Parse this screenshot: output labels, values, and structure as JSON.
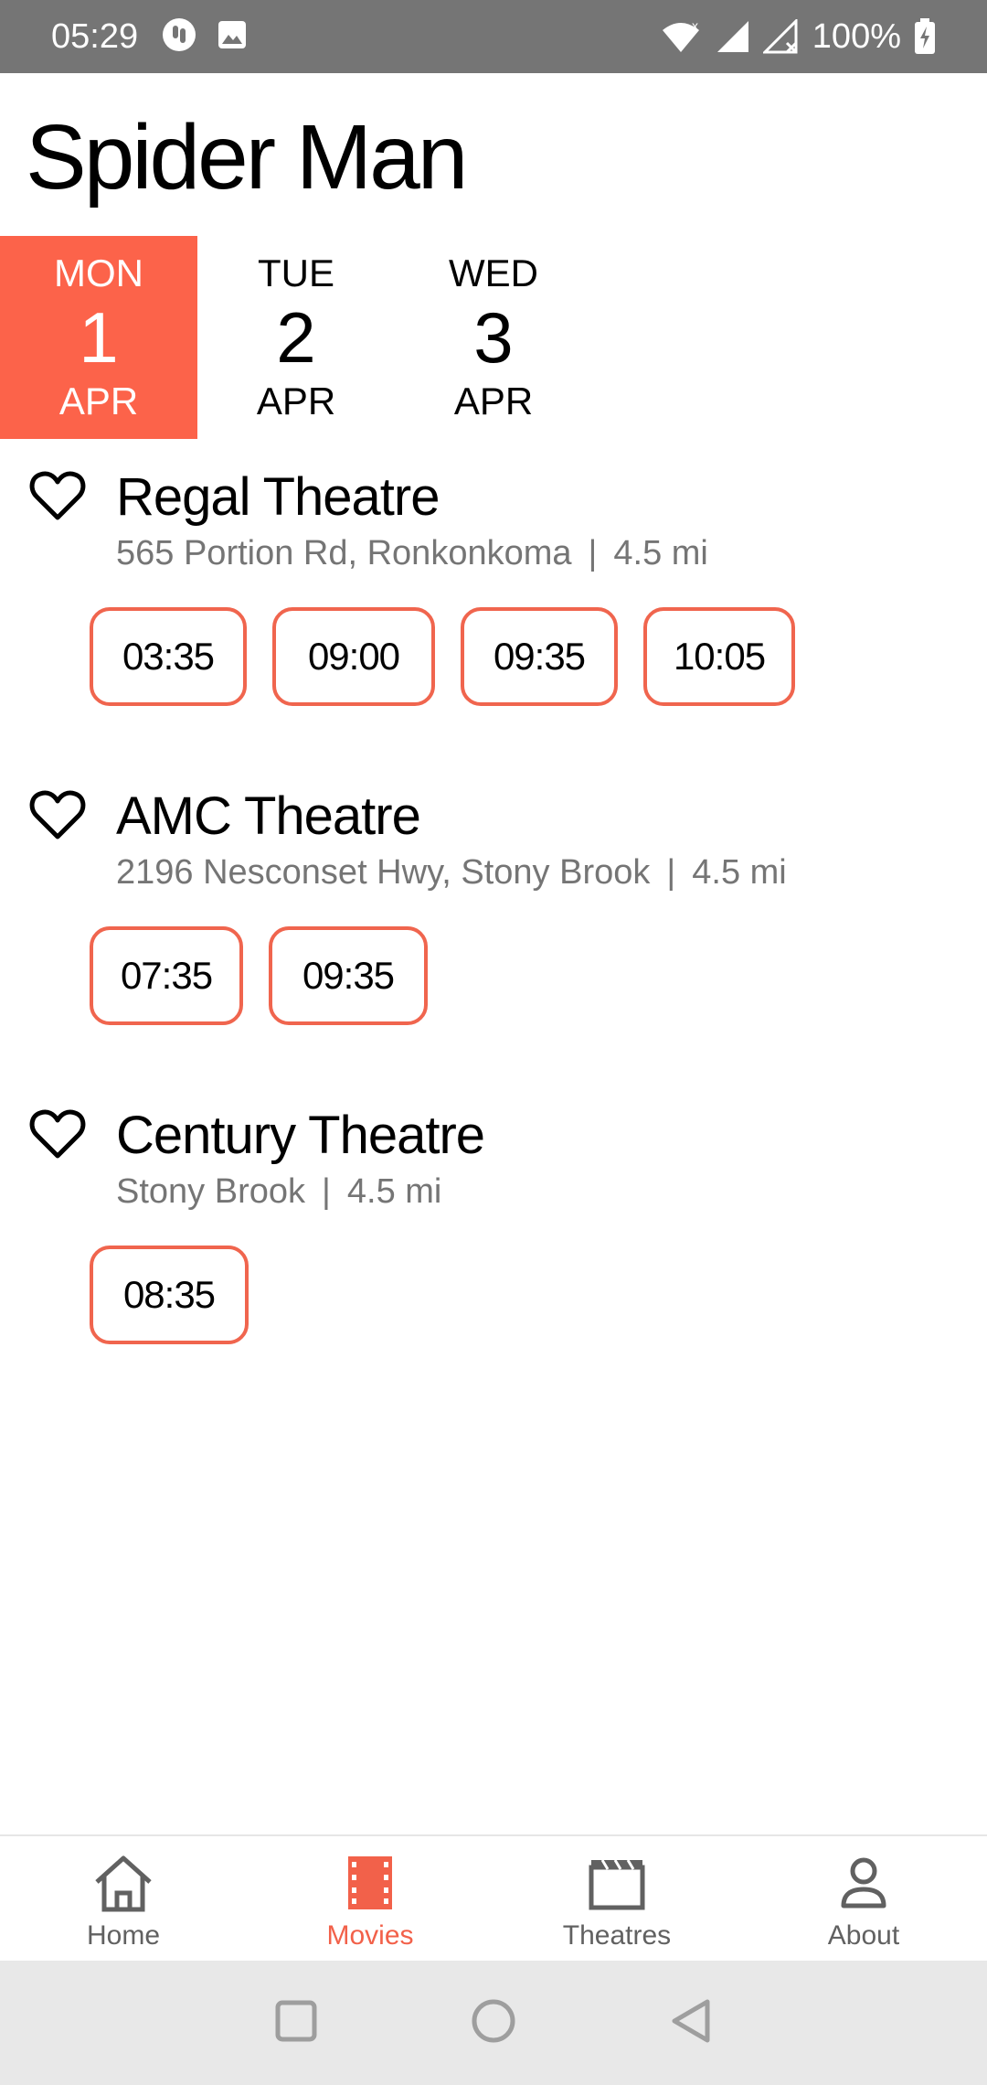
{
  "status_bar": {
    "time": "05:29",
    "battery": "100%",
    "icons": [
      "notification-app-icon",
      "image-icon",
      "wifi-icon",
      "signal-icon",
      "signal-no-service-icon",
      "battery-charging-icon"
    ]
  },
  "page": {
    "title": "Spider Man"
  },
  "dates": [
    {
      "dow": "MON",
      "day": "1",
      "month": "APR",
      "selected": true
    },
    {
      "dow": "TUE",
      "day": "2",
      "month": "APR",
      "selected": false
    },
    {
      "dow": "WED",
      "day": "3",
      "month": "APR",
      "selected": false
    }
  ],
  "theatres": [
    {
      "name": "Regal Theatre",
      "address": "565 Portion Rd, Ronkonkoma",
      "separator": "|",
      "distance": "4.5 mi",
      "showtimes": [
        "03:35",
        "09:00",
        "09:35",
        "10:05"
      ]
    },
    {
      "name": "AMC Theatre",
      "address": "2196 Nesconset Hwy, Stony Brook",
      "separator": "|",
      "distance": "4.5 mi",
      "showtimes": [
        "07:35",
        "09:35"
      ]
    },
    {
      "name": "Century Theatre",
      "address": "Stony Brook",
      "separator": "|",
      "distance": "4.5 mi",
      "showtimes": [
        "08:35"
      ]
    }
  ],
  "bottom_nav": [
    {
      "label": "Home",
      "icon": "home-icon",
      "active": false
    },
    {
      "label": "Movies",
      "icon": "film-icon",
      "active": true
    },
    {
      "label": "Theatres",
      "icon": "clapperboard-icon",
      "active": false
    },
    {
      "label": "About",
      "icon": "person-icon",
      "active": false
    }
  ],
  "colors": {
    "accent": "#fc634a",
    "status_bar": "#757575",
    "secondary_text": "#757575",
    "system_nav": "#e8e8e8"
  }
}
